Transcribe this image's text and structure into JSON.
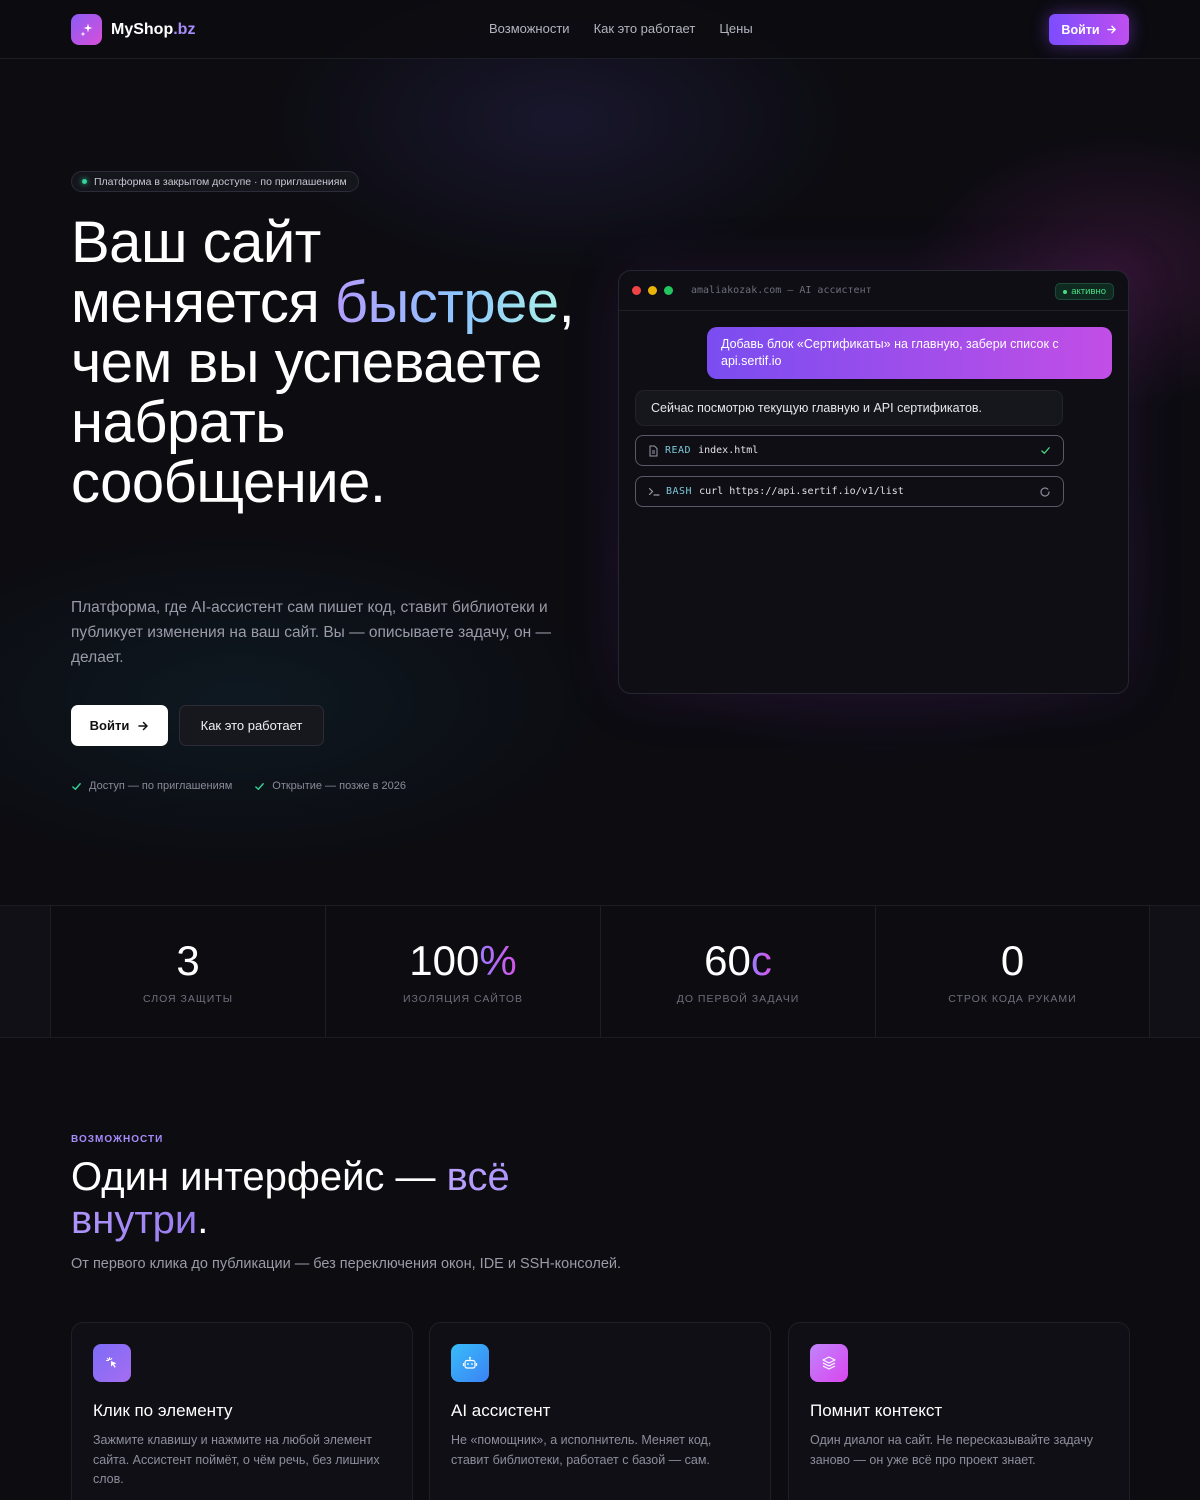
{
  "header": {
    "brand_name": "MyShop",
    "brand_tld": ".bz",
    "nav": [
      "Возможности",
      "Как это работает",
      "Цены"
    ],
    "login_label": "Войти"
  },
  "hero": {
    "pill_text": "Платформа в закрытом доступе · по приглашениям",
    "title_part1": "Ваш сайт меняется ",
    "title_highlight": "быстрее",
    "title_part2": ", чем вы успеваете набрать сообщение.",
    "subtitle": "Платформа, где AI-ассистент сам пишет код, ставит библиотеки и публикует изменения на ваш сайт. Вы — описываете задачу, он — делает.",
    "primary_button": "Войти",
    "secondary_button": "Как это работает",
    "checks": [
      "Доступ — по приглашениям",
      "Открытие — позже в 2026"
    ]
  },
  "terminal": {
    "title": "amaliakozak.com — AI ассистент",
    "status": "активно",
    "user_message": "Добавь блок «Сертификаты» на главную, забери список с api.sertif.io",
    "bot_message": "Сейчас посмотрю текущую главную и API сертификатов.",
    "tools": [
      {
        "kind": "READ",
        "arg": "index.html",
        "state": "done"
      },
      {
        "kind": "BASH",
        "arg": "curl https://api.sertif.io/v1/list",
        "state": "running"
      }
    ],
    "colors": {
      "red": "#ef4444",
      "yellow": "#eab308",
      "green": "#22c55e"
    }
  },
  "stats": [
    {
      "value": "3",
      "suffix": "",
      "label": "СЛОЯ ЗАЩИТЫ"
    },
    {
      "value": "100",
      "suffix": "%",
      "label": "ИЗОЛЯЦИЯ САЙТОВ"
    },
    {
      "value": "60",
      "suffix": "с",
      "label": "ДО ПЕРВОЙ ЗАДАЧИ"
    },
    {
      "value": "0",
      "suffix": "",
      "label": "СТРОК КОДА РУКАМИ"
    }
  ],
  "features": {
    "eyebrow": "ВОЗМОЖНОСТИ",
    "title_part1": "Один интерфейс — ",
    "title_highlight": "всё внутри",
    "title_part2": ".",
    "subtitle": "От первого клика до публикации — без переключения окон, IDE и SSH-консолей.",
    "cards": [
      {
        "icon": "cursor-click-icon",
        "title": "Клик по элементу",
        "text": "Зажмите клавишу и нажмите на любой элемент сайта. Ассистент поймёт, о чём речь, без лишних слов."
      },
      {
        "icon": "robot-icon",
        "title": "AI ассистент",
        "text": "Не «помощник», а исполнитель. Меняет код, ставит библиотеки, работает с базой — сам."
      },
      {
        "icon": "layers-icon",
        "title": "Помнит контекст",
        "text": "Один диалог на сайт. Не пересказывайте задачу заново — он уже всё про проект знает."
      }
    ]
  }
}
